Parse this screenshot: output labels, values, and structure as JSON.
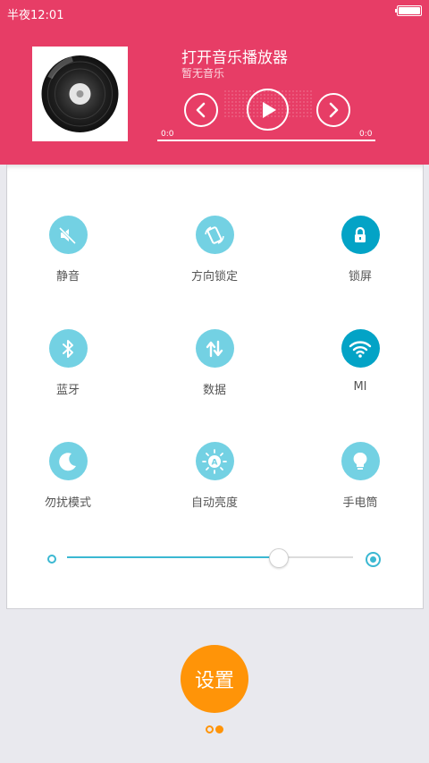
{
  "status_bar": {
    "time": "半夜12:01"
  },
  "player": {
    "title": "打开音乐播放器",
    "subtitle": "暂无音乐",
    "time_elapsed": "0:0",
    "time_total": "0:0",
    "progress_fraction": 0
  },
  "toggles": [
    {
      "label": "静音",
      "icon": "mute-icon",
      "active": false
    },
    {
      "label": "方向锁定",
      "icon": "rotation-lock-icon",
      "active": false
    },
    {
      "label": "锁屏",
      "icon": "lock-icon",
      "active": true
    },
    {
      "label": "蓝牙",
      "icon": "bluetooth-icon",
      "active": false
    },
    {
      "label": "数据",
      "icon": "data-arrows-icon",
      "active": false
    },
    {
      "label": "MI",
      "icon": "wifi-icon",
      "active": true
    },
    {
      "label": "勿扰模式",
      "icon": "moon-icon",
      "active": false
    },
    {
      "label": "自动亮度",
      "icon": "auto-brightness-icon",
      "active": false
    },
    {
      "label": "手电筒",
      "icon": "flashlight-bulb-icon",
      "active": false
    }
  ],
  "brightness": {
    "level_fraction": 0.74
  },
  "settings_button": {
    "label": "设置"
  },
  "pager": {
    "pages": 2,
    "current": 2
  },
  "colors": {
    "header": "#e73d66",
    "accent": "#3bb8d2",
    "icon_inactive": "#73d1e3",
    "icon_active": "#03a3c6",
    "settings": "#ff9408"
  }
}
